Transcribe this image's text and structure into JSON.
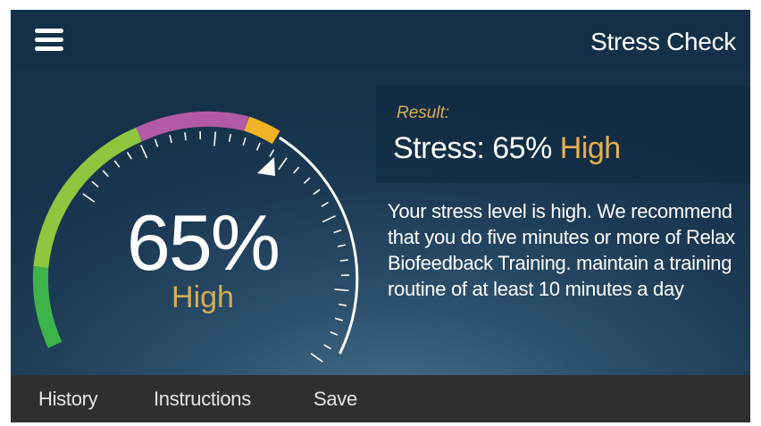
{
  "header": {
    "title": "Stress Check",
    "menu_icon": "hamburger-menu-icon"
  },
  "gauge": {
    "value_text": "65%",
    "level_text": "High",
    "value_fraction": 0.65,
    "colors": {
      "low": "#3cb44a",
      "moderate": "#8ec63f",
      "elevated": "#b35aa6",
      "high": "#f0b323",
      "remaining": "#ffffff"
    }
  },
  "result": {
    "label": "Result:",
    "prefix": "Stress: 65%",
    "level": "High"
  },
  "description": "Your stress level is high. We recommend that you do five minutes or more of Relax Biofeedback Training. maintain a training routine of at least 10 minutes a day",
  "tabs": {
    "history": "History",
    "instructions": "Instructions",
    "save": "Save"
  }
}
